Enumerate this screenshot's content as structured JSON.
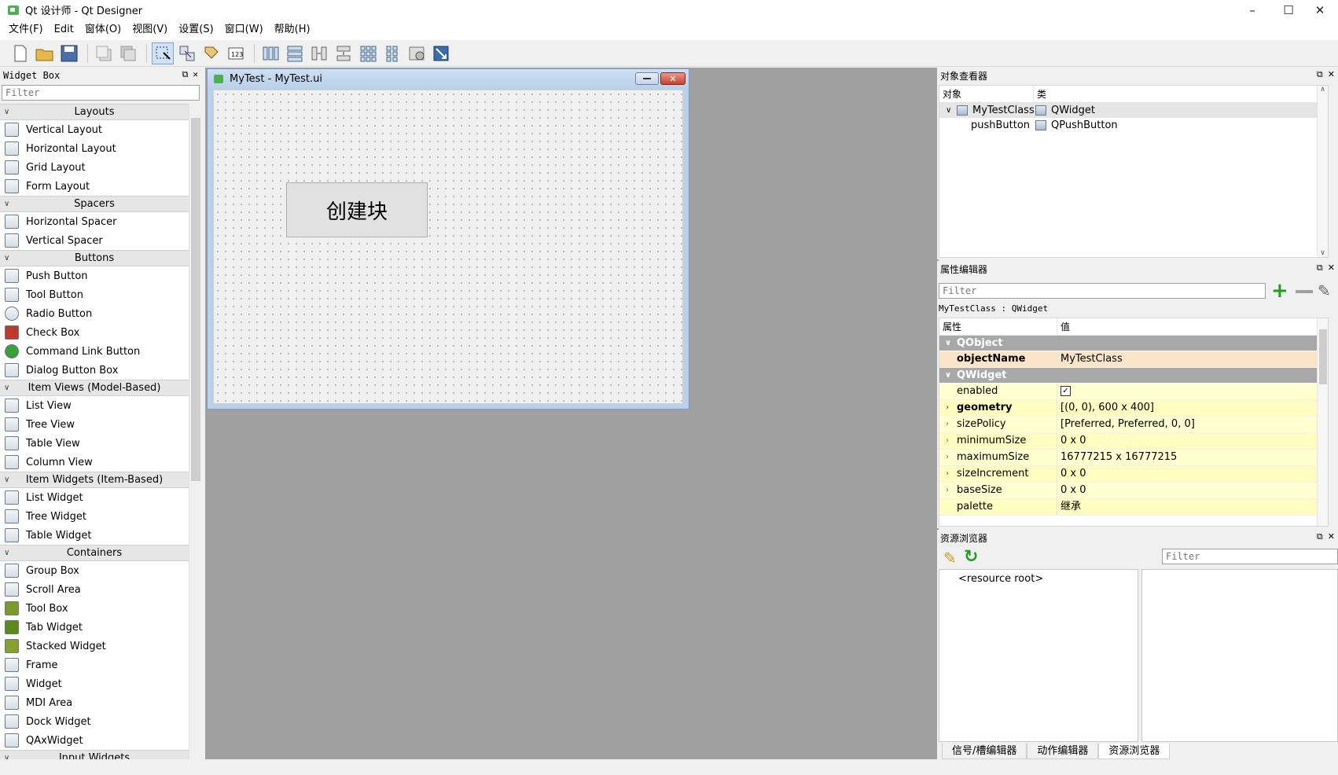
{
  "window": {
    "title": "Qt 设计师 - Qt Designer"
  },
  "menu": [
    "文件(F)",
    "Edit",
    "窗体(O)",
    "视图(V)",
    "设置(S)",
    "窗口(W)",
    "帮助(H)"
  ],
  "widget_box": {
    "title": "Widget Box",
    "filter_placeholder": "Filter",
    "categories": [
      {
        "name": "Layouts",
        "items": [
          "Vertical Layout",
          "Horizontal Layout",
          "Grid Layout",
          "Form Layout"
        ]
      },
      {
        "name": "Spacers",
        "items": [
          "Horizontal Spacer",
          "Vertical Spacer"
        ]
      },
      {
        "name": "Buttons",
        "items": [
          "Push Button",
          "Tool Button",
          "Radio Button",
          "Check Box",
          "Command Link Button",
          "Dialog Button Box"
        ]
      },
      {
        "name": "Item Views (Model-Based)",
        "items": [
          "List View",
          "Tree View",
          "Table View",
          "Column View"
        ]
      },
      {
        "name": "Item Widgets (Item-Based)",
        "items": [
          "List Widget",
          "Tree Widget",
          "Table Widget"
        ]
      },
      {
        "name": "Containers",
        "items": [
          "Group Box",
          "Scroll Area",
          "Tool Box",
          "Tab Widget",
          "Stacked Widget",
          "Frame",
          "Widget",
          "MDI Area",
          "Dock Widget",
          "QAxWidget"
        ]
      },
      {
        "name": "Input Widgets",
        "items": []
      }
    ]
  },
  "form": {
    "title": "MyTest - MyTest.ui",
    "button_text": "创建块"
  },
  "object_inspector": {
    "title": "对象查看器",
    "col_object": "对象",
    "col_class": "类",
    "rows": [
      {
        "object": "MyTestClass",
        "class": "QWidget"
      },
      {
        "object": "pushButton",
        "class": "QPushButton"
      }
    ]
  },
  "property_editor": {
    "title": "属性编辑器",
    "filter_placeholder": "Filter",
    "class_label": "MyTestClass : QWidget",
    "col_property": "属性",
    "col_value": "值",
    "group_qobject": "QObject",
    "group_qwidget": "QWidget",
    "object_name_key": "objectName",
    "object_name_value": "MyTestClass",
    "enabled_key": "enabled",
    "rows": [
      {
        "key": "geometry",
        "value": "[(0, 0), 600 x 400]"
      },
      {
        "key": "sizePolicy",
        "value": "[Preferred, Preferred, 0, 0]"
      },
      {
        "key": "minimumSize",
        "value": "0 x 0"
      },
      {
        "key": "maximumSize",
        "value": "16777215 x 16777215"
      },
      {
        "key": "sizeIncrement",
        "value": "0 x 0"
      },
      {
        "key": "baseSize",
        "value": "0 x 0"
      },
      {
        "key": "palette",
        "value": "继承"
      }
    ]
  },
  "resource_browser": {
    "title": "资源浏览器",
    "filter_placeholder": "Filter",
    "root": "<resource root>",
    "tabs": [
      "信号/槽编辑器",
      "动作编辑器",
      "资源浏览器"
    ]
  }
}
